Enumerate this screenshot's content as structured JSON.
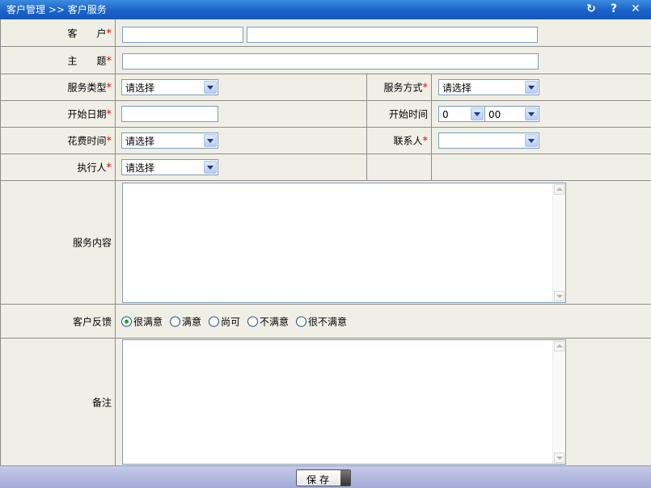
{
  "window": {
    "breadcrumb": "客户管理 >> 客户服务",
    "icons": [
      "refresh-icon",
      "help-icon",
      "close-icon"
    ],
    "help_glyph": "?",
    "close_glyph": "✕",
    "refresh_glyph": "↻"
  },
  "form": {
    "customer_label": "客　　户",
    "subject_label": "主　　题",
    "service_type_label": "服务类型",
    "service_type_value": "请选择",
    "service_mode_label": "服务方式",
    "service_mode_value": "请选择",
    "start_date_label": "开始日期",
    "start_time_label": "开始时间",
    "start_hour_value": "0",
    "start_minute_value": "00",
    "time_spent_label": "花费时间",
    "time_spent_value": "请选择",
    "contact_label": "联系人",
    "contact_value": "",
    "executor_label": "执行人",
    "executor_value": "请选择",
    "content_label": "服务内容",
    "feedback_label": "客户反馈",
    "feedback_options": [
      "很满意",
      "满意",
      "尚可",
      "不满意",
      "很不满意"
    ],
    "feedback_selected": "很满意",
    "remark_label": "备注",
    "required_mark": "*"
  },
  "footer": {
    "save_label": "保存"
  },
  "colors": {
    "titlebar": "#1a62c8",
    "background": "#f0efe6",
    "required": "#e00000",
    "footer": "#a3aad8"
  }
}
